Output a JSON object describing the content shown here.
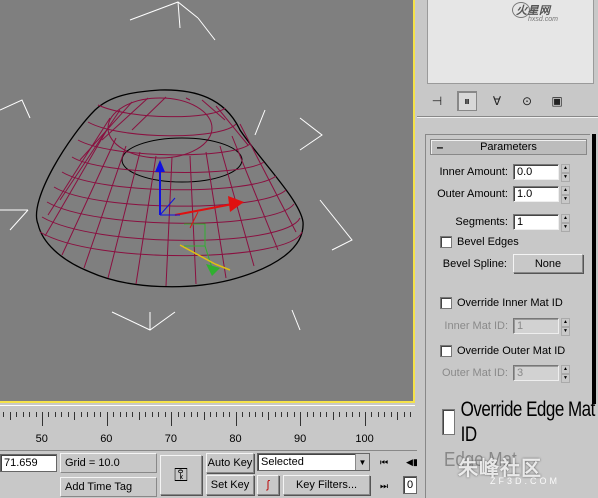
{
  "watermark_top": {
    "brand": "火星网",
    "sub": "hxsd.com"
  },
  "watermark_bottom": {
    "brand": "朱峰社区",
    "sub": "ZF3D.COM"
  },
  "modifier_tabs": [
    "pin-stack-icon",
    "show-end-result-icon",
    "make-unique-icon",
    "remove-modifier-icon",
    "configure-sets-icon"
  ],
  "parameters": {
    "title": "Parameters",
    "inner_amount_label": "Inner Amount:",
    "inner_amount_value": "0.0",
    "outer_amount_label": "Outer Amount:",
    "outer_amount_value": "1.0",
    "segments_label": "Segments:",
    "segments_value": "1",
    "bevel_edges_label": "Bevel Edges",
    "bevel_spline_label": "Bevel Spline:",
    "bevel_spline_value": "None",
    "override_inner_label": "Override Inner Mat ID",
    "inner_mat_id_label": "Inner Mat ID:",
    "inner_mat_id_value": "1",
    "override_outer_label": "Override Outer Mat ID",
    "outer_mat_id_label": "Outer Mat ID:",
    "outer_mat_id_value": "3",
    "override_edge_label": "Override Edge Mat ID",
    "edge_mat_id_label": "Edge Mat"
  },
  "timeline": {
    "ticks": [
      "50",
      "60",
      "70",
      "80",
      "90",
      "100"
    ]
  },
  "status": {
    "coord_value": "71.659",
    "grid_label": "Grid = 10.0",
    "add_time_tag": "Add Time Tag",
    "auto_key": "Auto Key",
    "set_key": "Set Key",
    "selected_value": "Selected",
    "key_filters": "Key Filters...",
    "frame_value": "0"
  },
  "colors": {
    "viewport_bg": "#7f7f7f",
    "viewport_border": "#f5e24a",
    "mesh": "#8a1040",
    "panel_bg": "#c8c8c8"
  }
}
